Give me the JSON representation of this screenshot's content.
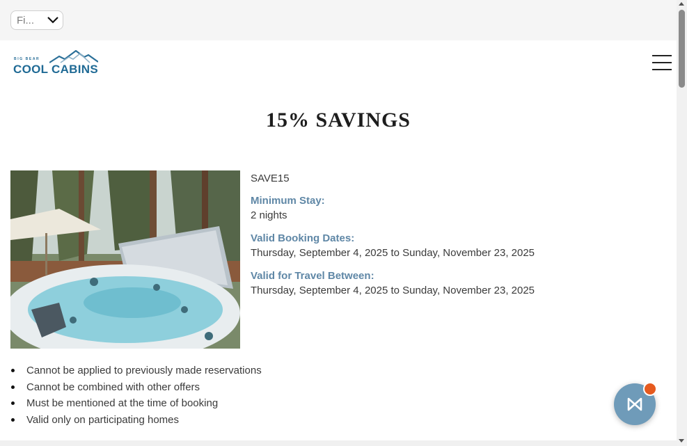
{
  "language_select": {
    "value": "Fi...",
    "icon": "chevron-down-icon"
  },
  "header": {
    "logo_small": "BIG BEAR",
    "logo_main": "COOL CABINS",
    "menu_icon": "hamburger-menu-icon"
  },
  "page_title": "15% SAVINGS",
  "promo": {
    "code": "SAVE15",
    "minimum_stay_label": "Minimum Stay:",
    "minimum_stay_value": "2 nights",
    "booking_dates_label": "Valid Booking Dates:",
    "booking_dates_value": "Thursday, September 4, 2025 to Sunday, November 23, 2025",
    "travel_dates_label": "Valid for Travel Between:",
    "travel_dates_value": "Thursday, September 4, 2025 to Sunday, November 23, 2025"
  },
  "conditions": [
    "Cannot be applied to previously made reservations",
    "Cannot be combined with other offers",
    "Must be mentioned at the time of booking",
    "Valid only on participating homes"
  ],
  "chat": {
    "icon": "chat-logo-icon",
    "badge_color": "#e65a1e"
  },
  "colors": {
    "brand": "#1f6a95",
    "label": "#5f87a6",
    "chat_button": "#6f9bb9"
  }
}
